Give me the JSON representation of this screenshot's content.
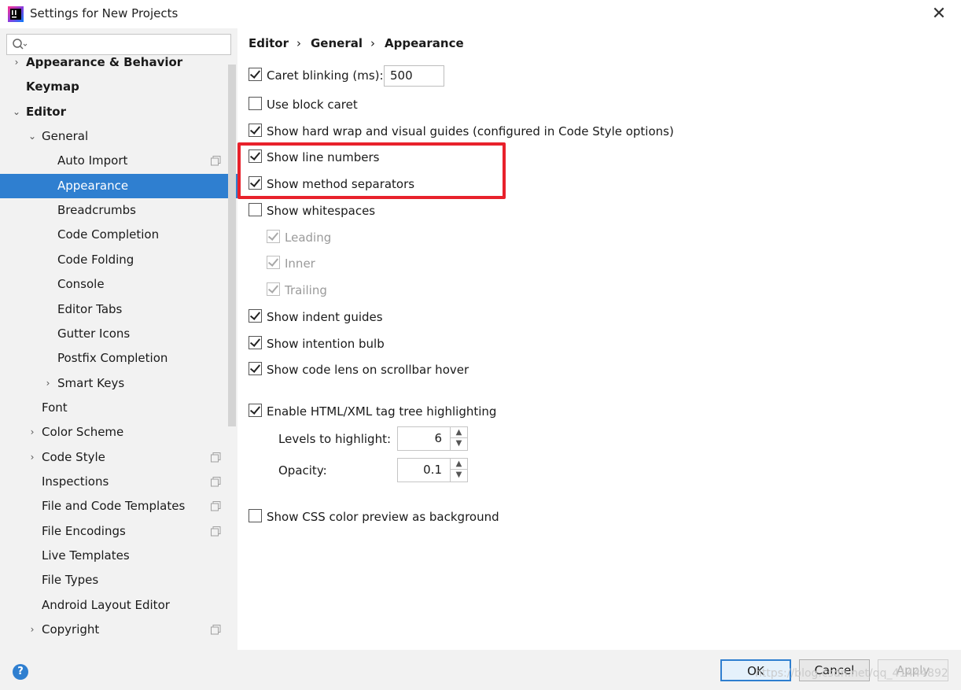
{
  "window": {
    "title": "Settings for New Projects",
    "close_glyph": "✕"
  },
  "search": {
    "placeholder": ""
  },
  "sidebar": {
    "items": [
      {
        "label": "Appearance & Behavior",
        "arrow": "›",
        "bold": true
      },
      {
        "label": "Keymap",
        "bold": true
      },
      {
        "label": "Editor",
        "arrow": "⌄",
        "bold": true
      },
      {
        "label": "General",
        "arrow": "⌄"
      },
      {
        "label": "Auto Import",
        "copy_icon": true
      },
      {
        "label": "Appearance",
        "selected": true
      },
      {
        "label": "Breadcrumbs"
      },
      {
        "label": "Code Completion"
      },
      {
        "label": "Code Folding"
      },
      {
        "label": "Console"
      },
      {
        "label": "Editor Tabs"
      },
      {
        "label": "Gutter Icons"
      },
      {
        "label": "Postfix Completion"
      },
      {
        "label": "Smart Keys",
        "arrow": "›"
      },
      {
        "label": "Font"
      },
      {
        "label": "Color Scheme",
        "arrow": "›"
      },
      {
        "label": "Code Style",
        "arrow": "›",
        "copy_icon": true
      },
      {
        "label": "Inspections",
        "copy_icon": true
      },
      {
        "label": "File and Code Templates",
        "copy_icon": true
      },
      {
        "label": "File Encodings",
        "copy_icon": true
      },
      {
        "label": "Live Templates"
      },
      {
        "label": "File Types"
      },
      {
        "label": "Android Layout Editor"
      },
      {
        "label": "Copyright",
        "arrow": "›",
        "copy_icon": true
      }
    ]
  },
  "breadcrumb": {
    "part1": "Editor",
    "part2": "General",
    "part3": "Appearance",
    "separator": "›"
  },
  "options": {
    "caret_blinking": {
      "label": "Caret blinking (ms):",
      "checked": true,
      "value": "500"
    },
    "block_caret": {
      "label": "Use block caret",
      "checked": false
    },
    "hard_wrap": {
      "label": "Show hard wrap and visual guides (configured in Code Style options)",
      "checked": true
    },
    "line_numbers": {
      "label": "Show line numbers",
      "checked": true
    },
    "method_separators": {
      "label": "Show method separators",
      "checked": true
    },
    "whitespaces": {
      "label": "Show whitespaces",
      "checked": false
    },
    "leading": {
      "label": "Leading",
      "checked": true
    },
    "inner": {
      "label": "Inner",
      "checked": true
    },
    "trailing": {
      "label": "Trailing",
      "checked": true
    },
    "indent_guides": {
      "label": "Show indent guides",
      "checked": true
    },
    "intention_bulb": {
      "label": "Show intention bulb",
      "checked": true
    },
    "code_lens": {
      "label": "Show code lens on scrollbar hover",
      "checked": true
    },
    "tag_tree": {
      "label": "Enable HTML/XML tag tree highlighting",
      "checked": true
    },
    "levels": {
      "label": "Levels to highlight:",
      "value": "6"
    },
    "opacity": {
      "label": "Opacity:",
      "value": "0.1"
    },
    "css_preview": {
      "label": "Show CSS color preview as background",
      "checked": false
    }
  },
  "buttons": {
    "ok": "OK",
    "cancel": "Cancel",
    "apply": "Apply",
    "help": "?"
  },
  "watermark": "https://blog.csdn.net/qq_41444892",
  "colors": {
    "selection": "#2f7fd0",
    "highlight_frame": "#e8212b",
    "sidebar_bg": "#f2f2f2"
  }
}
